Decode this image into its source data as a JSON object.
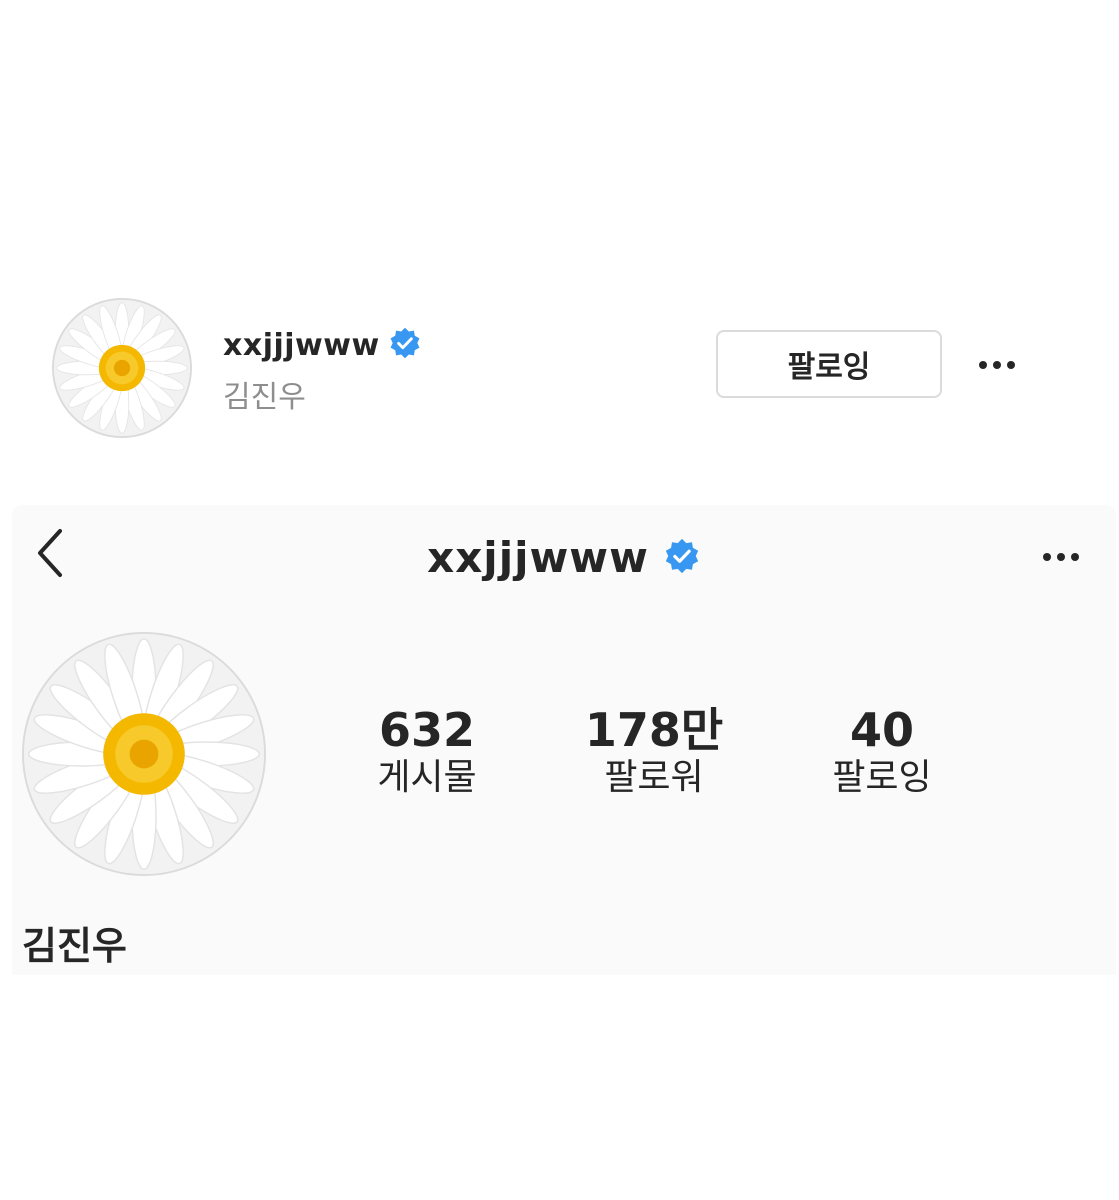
{
  "top_card": {
    "username": "xxjjjwww",
    "full_name": "김진우",
    "follow_button_label": "팔로잉",
    "more_icon": "more-horizontal-icon"
  },
  "profile_panel": {
    "header_username": "xxjjjwww",
    "back_icon": "chevron-left-icon",
    "more_icon": "more-horizontal-icon",
    "stats": {
      "posts": {
        "value": "632",
        "label": "게시물"
      },
      "followers": {
        "value": "178만",
        "label": "팔로워"
      },
      "following": {
        "value": "40",
        "label": "팔로잉"
      }
    },
    "full_name": "김진우"
  },
  "colors": {
    "verified_badge": "#3897f0",
    "panel_background": "#fafafa",
    "secondary_text": "#8e8e8e"
  }
}
